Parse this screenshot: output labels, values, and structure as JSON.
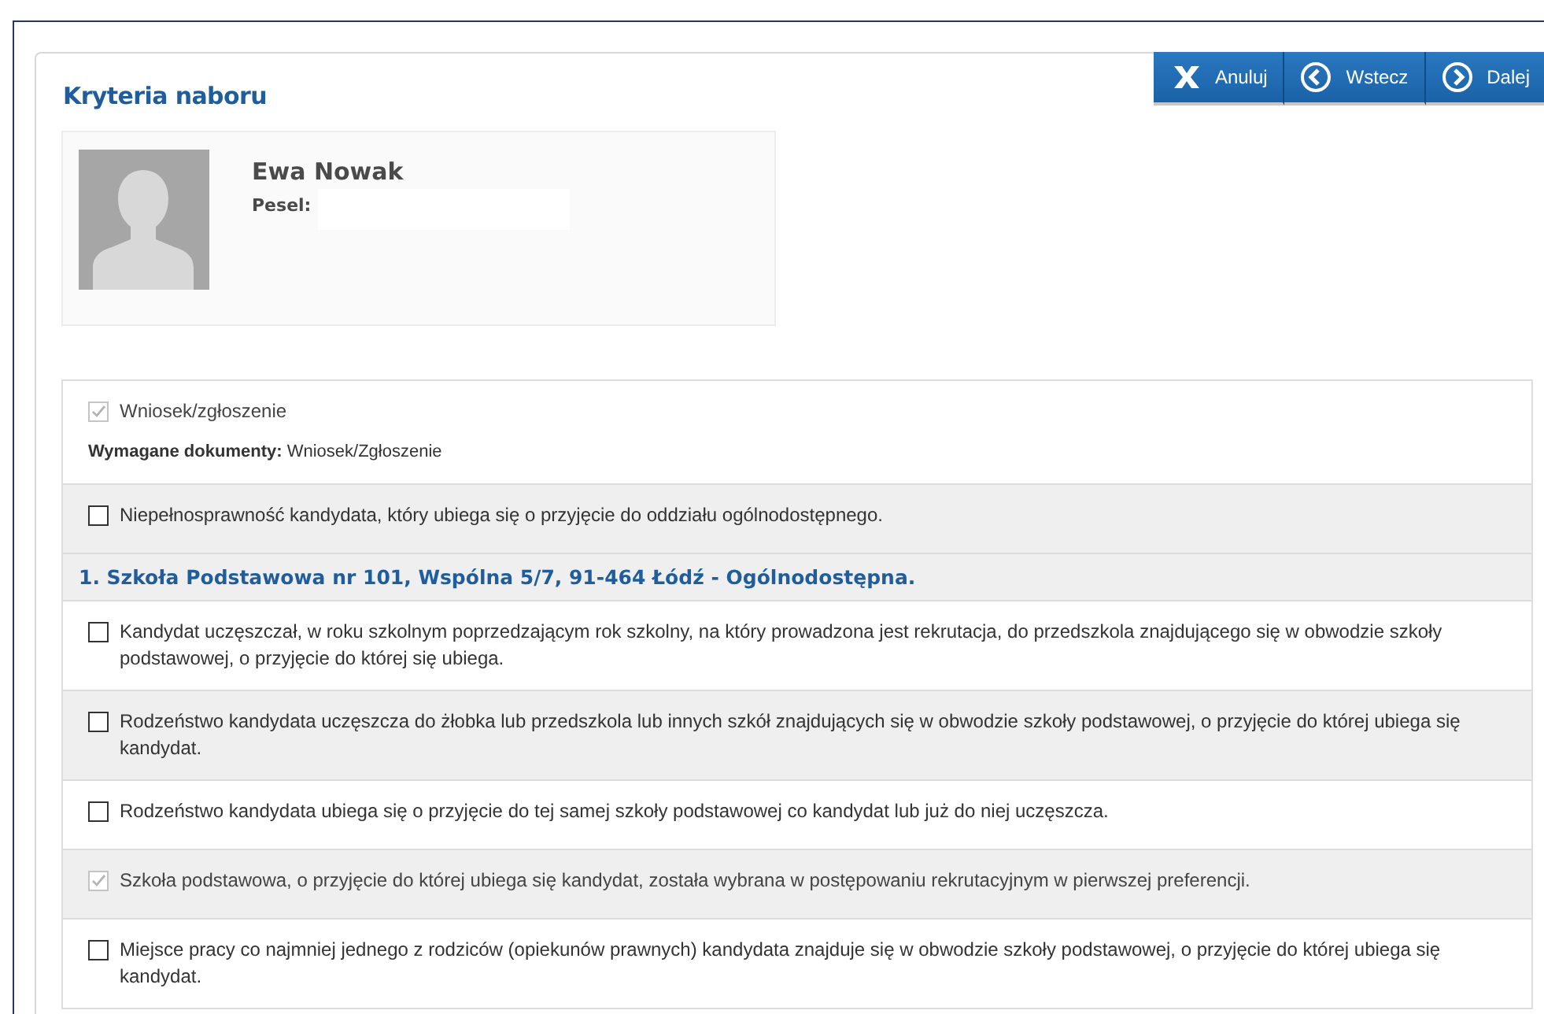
{
  "page": {
    "title": "Kryteria naboru"
  },
  "buttons": [
    {
      "kind": "cancel",
      "label": "Anuluj"
    },
    {
      "kind": "back",
      "label": "Wstecz"
    },
    {
      "kind": "next",
      "label": "Dalej"
    }
  ],
  "candidate": {
    "name": "Ewa Nowak",
    "pesel_label": "Pesel:"
  },
  "general_criteria": [
    {
      "label": "Wniosek/zgłoszenie",
      "checked": true,
      "disabled": true,
      "documents_label": "Wymagane dokumenty:",
      "documents": "Wniosek/Zgłoszenie"
    },
    {
      "label": "Niepełnosprawność kandydata, który ubiega się o przyjęcie do oddziału ogólnodostępnego.",
      "checked": false,
      "disabled": false
    }
  ],
  "schools": [
    {
      "heading": "1. Szkoła Podstawowa nr 101, Wspólna 5/7, 91-464 Łódź - Ogólnodostępna.",
      "criteria": [
        {
          "label": "Kandydat uczęszczał, w roku szkolnym poprzedzającym rok szkolny, na który prowadzona jest rekrutacja, do przedszkola znajdującego się w obwodzie szkoły podstawowej, o przyjęcie do której się ubiega.",
          "checked": false,
          "disabled": false
        },
        {
          "label": "Rodzeństwo kandydata uczęszcza do żłobka lub przedszkola lub innych szkół znajdujących się w obwodzie szkoły podstawowej, o przyjęcie do której ubiega się kandydat.",
          "checked": false,
          "disabled": false
        },
        {
          "label": "Rodzeństwo kandydata ubiega się o przyjęcie do tej samej szkoły podstawowej co kandydat lub już do niej uczęszcza.",
          "checked": false,
          "disabled": false
        },
        {
          "label": "Szkoła podstawowa, o przyjęcie do której ubiega się kandydat, została wybrana w postępowaniu rekrutacyjnym w pierwszej preferencji.",
          "checked": true,
          "disabled": true
        },
        {
          "label": "Miejsce pracy co najmniej jednego z rodziców (opiekunów prawnych) kandydata znajduje się w obwodzie szkoły podstawowej, o przyjęcie do której ubiega się kandydat.",
          "checked": false,
          "disabled": false
        }
      ]
    }
  ]
}
